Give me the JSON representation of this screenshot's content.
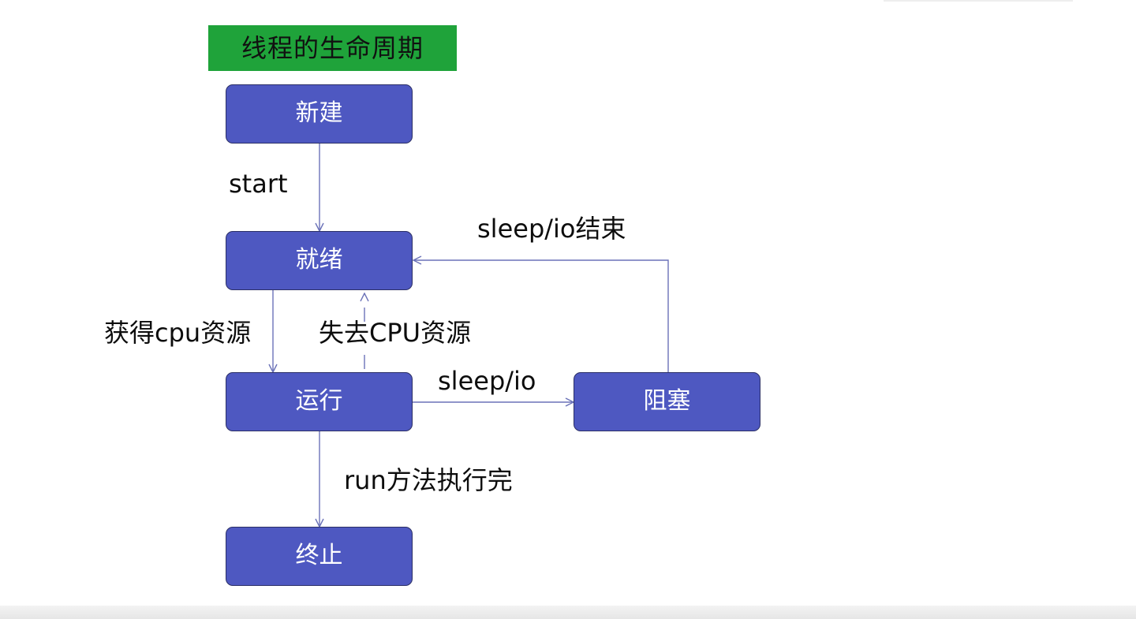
{
  "title": "线程的生命周期",
  "states": {
    "new": "新建",
    "ready": "就绪",
    "running": "运行",
    "blocked": "阻塞",
    "terminated": "终止"
  },
  "transitions": {
    "start": "start",
    "get_cpu": "获得cpu资源",
    "lose_cpu": "失去CPU资源",
    "sleep_io": "sleep/io",
    "sleep_io_end": "sleep/io结束",
    "run_done": "run方法执行完"
  },
  "colors": {
    "title_bg": "#1fa33a",
    "state_fill": "#4e58c1",
    "state_border": "#2b2f66",
    "arrow": "#6b72b8"
  }
}
